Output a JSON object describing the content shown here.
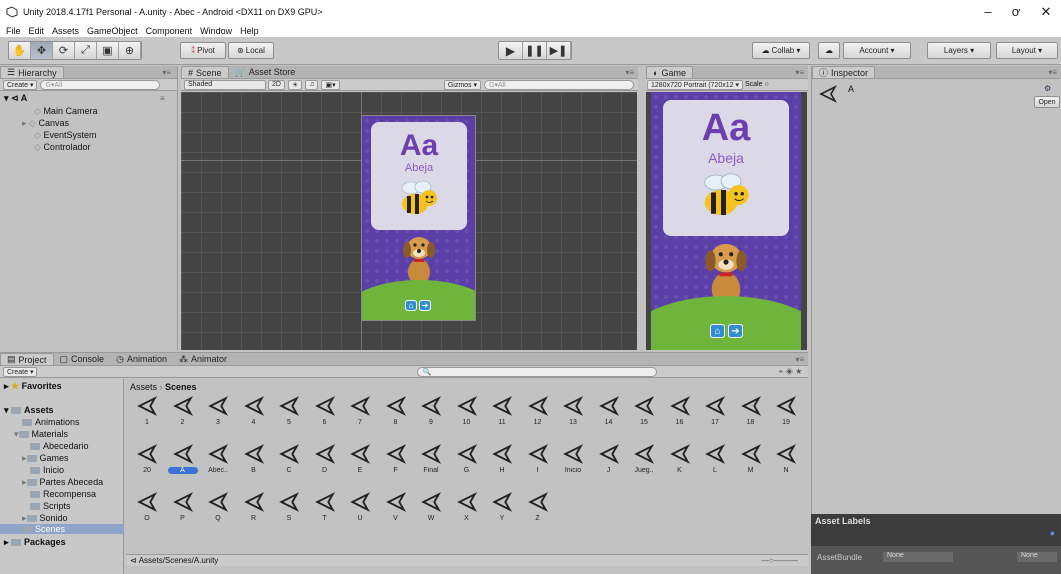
{
  "window": {
    "title": "Unity 2018.4.17f1 Personal - A.unity - Abec - Android <DX11 on DX9 GPU>",
    "min": "–",
    "max": "ơ",
    "close": "✕"
  },
  "menu": [
    "File",
    "Edit",
    "Assets",
    "GameObject",
    "Component",
    "Window",
    "Help"
  ],
  "toolbar": {
    "pivot": "Pivot",
    "local": "Local",
    "collab": "Collab ▾",
    "account": "Account ▾",
    "layers": "Layers ▾",
    "layout": "Layout ▾"
  },
  "hierarchy": {
    "tab": "Hierarchy",
    "create": "Create ▾",
    "search_placeholder": "G▾All",
    "scene": "A",
    "items": [
      "Main Camera",
      "Canvas",
      "EventSystem",
      "Controlador"
    ]
  },
  "scene": {
    "tabs": [
      "Scene",
      "Asset Store"
    ],
    "shaded": "Shaded",
    "mode2d": "2D",
    "gizmos": "Gizmos ▾",
    "search_placeholder": "G▾All"
  },
  "game": {
    "tab": "Game",
    "resolution": "1280x720 Portrait (720x12 ▾",
    "scale": "Scale"
  },
  "card": {
    "letter": "Aa",
    "word": "Abeja"
  },
  "inspector": {
    "tab": "Inspector",
    "object": "A",
    "open": "Open"
  },
  "project": {
    "tabs": [
      "Project",
      "Console",
      "Animation",
      "Animator"
    ],
    "create": "Create ▾",
    "favorites": "Favorites",
    "assets": "Assets",
    "packages": "Packages",
    "tree": [
      "Animations",
      "Materials",
      "Abecedario",
      "Games",
      "Inicio",
      "Partes Abeceda",
      "Recompensa",
      "Scripts",
      "Sonido",
      "Scenes"
    ],
    "breadcrumb": [
      "Assets",
      "Scenes"
    ],
    "row1": [
      "1",
      "2",
      "3",
      "4",
      "5",
      "6",
      "7",
      "8",
      "9",
      "10",
      "11",
      "12",
      "13",
      "14",
      "15",
      "16",
      "17",
      "18",
      "19"
    ],
    "row2": [
      "20",
      "A",
      "Abec..",
      "B",
      "C",
      "D",
      "E",
      "F",
      "Final",
      "G",
      "H",
      "I",
      "Inicio",
      "J",
      "Jueg..",
      "K",
      "L",
      "M",
      "N"
    ],
    "row3": [
      "O",
      "P",
      "Q",
      "R",
      "S",
      "T",
      "U",
      "V",
      "W",
      "X",
      "Y",
      "Z"
    ],
    "path": "Assets/Scenes/A.unity"
  },
  "assetLabels": {
    "title": "Asset Labels",
    "bundle": "AssetBundle",
    "none1": "None",
    "none2": "None"
  }
}
